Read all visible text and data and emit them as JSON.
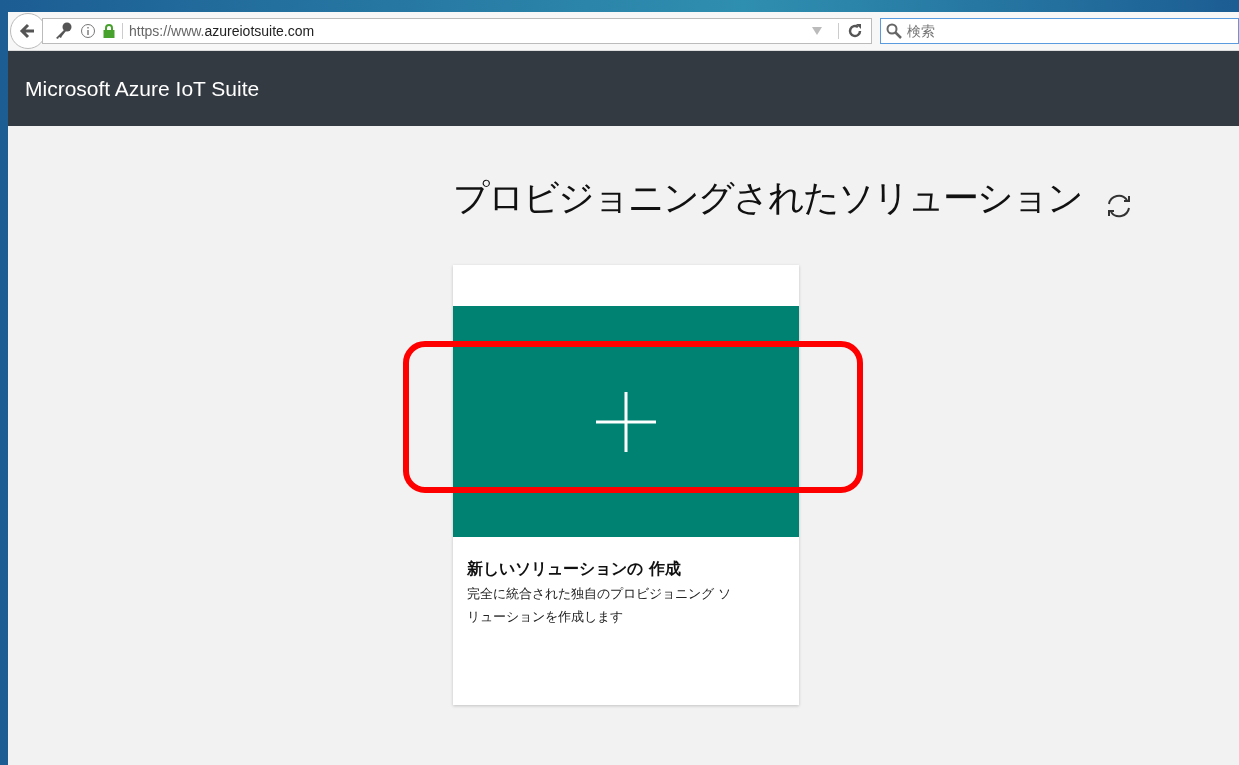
{
  "browser": {
    "url_scheme": "https://www.",
    "url_host": "azureiotsuite.com",
    "search": {
      "placeholder": "検索"
    }
  },
  "app": {
    "title": "Microsoft Azure IoT Suite"
  },
  "page": {
    "heading": "プロビジョニングされたソリューション"
  },
  "card": {
    "title": "新しいソリューションの 作成",
    "description": "完全に統合された独自のプロビジョニング ソリューションを作成します",
    "highlighted": true
  }
}
